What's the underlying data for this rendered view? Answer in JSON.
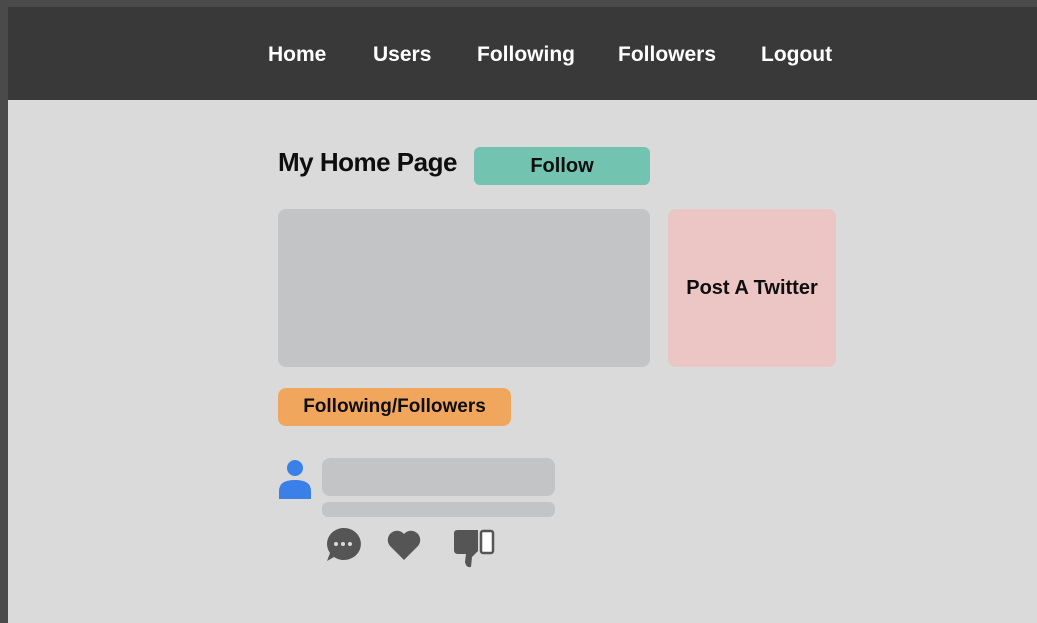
{
  "nav": {
    "items": [
      {
        "label": "Home"
      },
      {
        "label": "Users"
      },
      {
        "label": "Following"
      },
      {
        "label": "Followers"
      },
      {
        "label": "Logout"
      }
    ]
  },
  "page": {
    "title": "My Home Page",
    "follow_label": "Follow",
    "post_label": "Post A Twitter",
    "following_followers_label": "Following/Followers"
  },
  "icons": {
    "avatar": "user-icon",
    "comment": "comment-icon",
    "like": "heart-icon",
    "dislike": "thumbs-down-icon"
  },
  "colors": {
    "navbar": "#3a393a",
    "background": "#dadada",
    "follow_button": "#72c3b0",
    "post_button": "#ecc5c5",
    "following_followers_button": "#f1a65d",
    "placeholder": "#c3c4c6",
    "avatar": "#3b7fe8",
    "action_icons": "#555555"
  }
}
